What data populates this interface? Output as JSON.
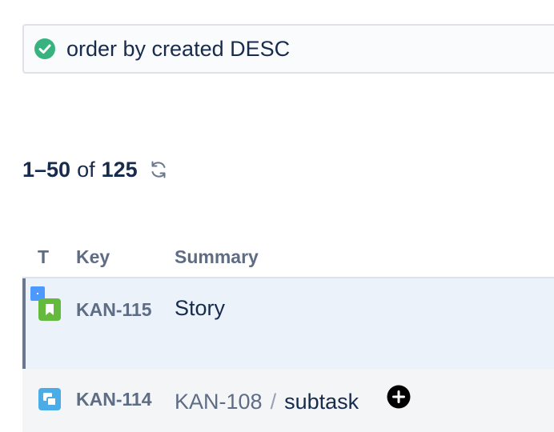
{
  "query": {
    "status_icon": "check-circle-icon",
    "status_color": "#36b37e",
    "text": "order by created DESC"
  },
  "results": {
    "range": "1–50",
    "of_label": "of",
    "total": "125",
    "refresh_icon": "refresh-icon"
  },
  "table": {
    "columns": {
      "type": "T",
      "key": "Key",
      "summary": "Summary"
    },
    "rows": [
      {
        "type_icon": "story-icon",
        "type_color": "#63ba3c",
        "key": "KAN-115",
        "summary": "Story",
        "selected": true
      },
      {
        "type_icon": "subtask-icon",
        "type_color": "#4bade8",
        "key": "KAN-114",
        "parent_key": "KAN-108",
        "separator": "/",
        "summary": "subtask",
        "action_icon": "add-circle-icon"
      }
    ]
  }
}
